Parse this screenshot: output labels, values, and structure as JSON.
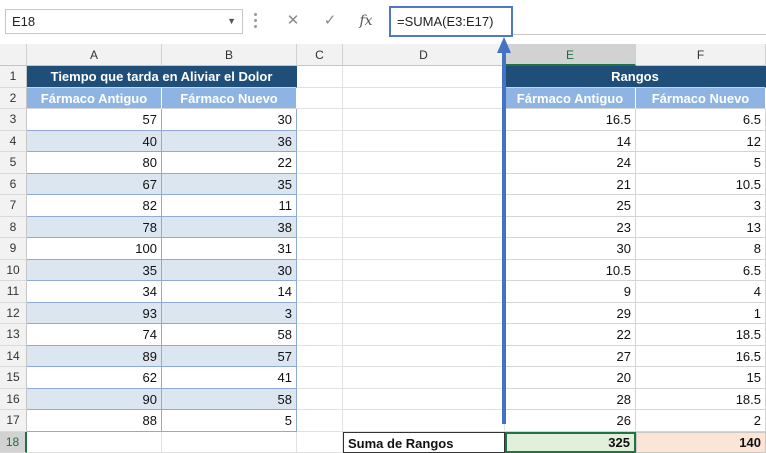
{
  "formula_bar": {
    "name_box": "E18",
    "cancel_icon": "✕",
    "enter_icon": "✓",
    "fx_label": "fx",
    "formula": "=SUMA(E3:E17)"
  },
  "columns": [
    "A",
    "B",
    "C",
    "D",
    "E",
    "F"
  ],
  "rows": [
    "1",
    "2",
    "3",
    "4",
    "5",
    "6",
    "7",
    "8",
    "9",
    "10",
    "11",
    "12",
    "13",
    "14",
    "15",
    "16",
    "17",
    "18"
  ],
  "left_table": {
    "title": "Tiempo que tarda en Aliviar el Dolor",
    "headers": [
      "Fármaco Antiguo",
      "Fármaco Nuevo"
    ],
    "values": [
      [
        57,
        30
      ],
      [
        40,
        36
      ],
      [
        80,
        22
      ],
      [
        67,
        35
      ],
      [
        82,
        11
      ],
      [
        78,
        38
      ],
      [
        100,
        31
      ],
      [
        35,
        30
      ],
      [
        34,
        14
      ],
      [
        93,
        3
      ],
      [
        74,
        58
      ],
      [
        89,
        57
      ],
      [
        62,
        41
      ],
      [
        90,
        58
      ],
      [
        88,
        5
      ]
    ]
  },
  "right_table": {
    "title": "Rangos",
    "headers": [
      "Fármaco Antiguo",
      "Fármaco Nuevo"
    ],
    "values": [
      [
        "16.5",
        "6.5"
      ],
      [
        "14",
        "12"
      ],
      [
        "24",
        "5"
      ],
      [
        "21",
        "10.5"
      ],
      [
        "25",
        "3"
      ],
      [
        "23",
        "13"
      ],
      [
        "30",
        "8"
      ],
      [
        "10.5",
        "6.5"
      ],
      [
        "9",
        "4"
      ],
      [
        "29",
        "1"
      ],
      [
        "22",
        "18.5"
      ],
      [
        "27",
        "16.5"
      ],
      [
        "20",
        "15"
      ],
      [
        "28",
        "18.5"
      ],
      [
        "26",
        "2"
      ]
    ]
  },
  "summary": {
    "label": "Suma de Rangos",
    "old_sum": "325",
    "new_sum": "140"
  },
  "colors": {
    "title_bg": "#1f4e79",
    "header_bg": "#8db4e2",
    "band_bg": "#dce6f1",
    "selection": "#217346",
    "arrow": "#4472c4"
  },
  "selected_cell": "E18"
}
